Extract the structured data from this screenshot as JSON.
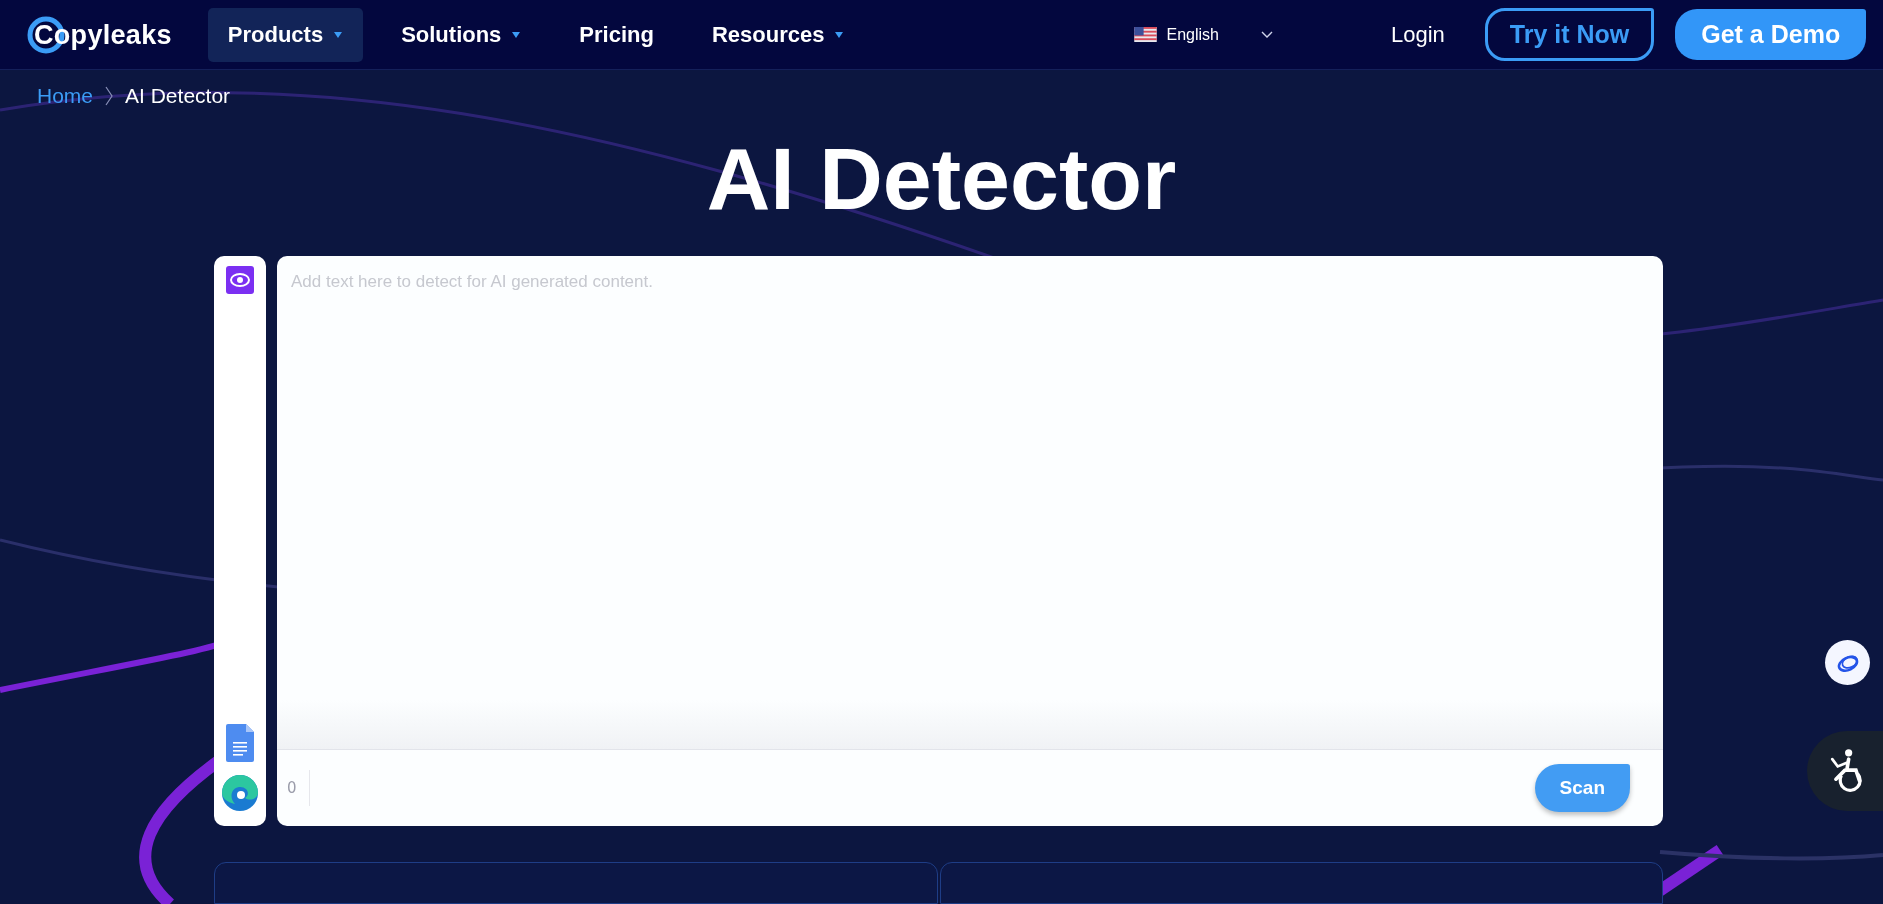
{
  "nav": {
    "logo": "Copyleaks",
    "items": [
      {
        "label": "Products",
        "dropdown": true,
        "selected": true
      },
      {
        "label": "Solutions",
        "dropdown": true,
        "selected": false
      },
      {
        "label": "Pricing",
        "dropdown": false,
        "selected": false
      },
      {
        "label": "Resources",
        "dropdown": true,
        "selected": false
      }
    ],
    "language": "English",
    "login": "Login",
    "try_button": "Try it Now",
    "demo_button": "Get a Demo"
  },
  "breadcrumb": [
    {
      "label": "Home",
      "kind": "link"
    },
    {
      "label": "AI Detector",
      "kind": "current"
    }
  ],
  "title": "AI Detector",
  "editor": {
    "placeholder": "Add text here to detect for AI generated content.",
    "word_count": "0",
    "scan_button": "Scan"
  }
}
